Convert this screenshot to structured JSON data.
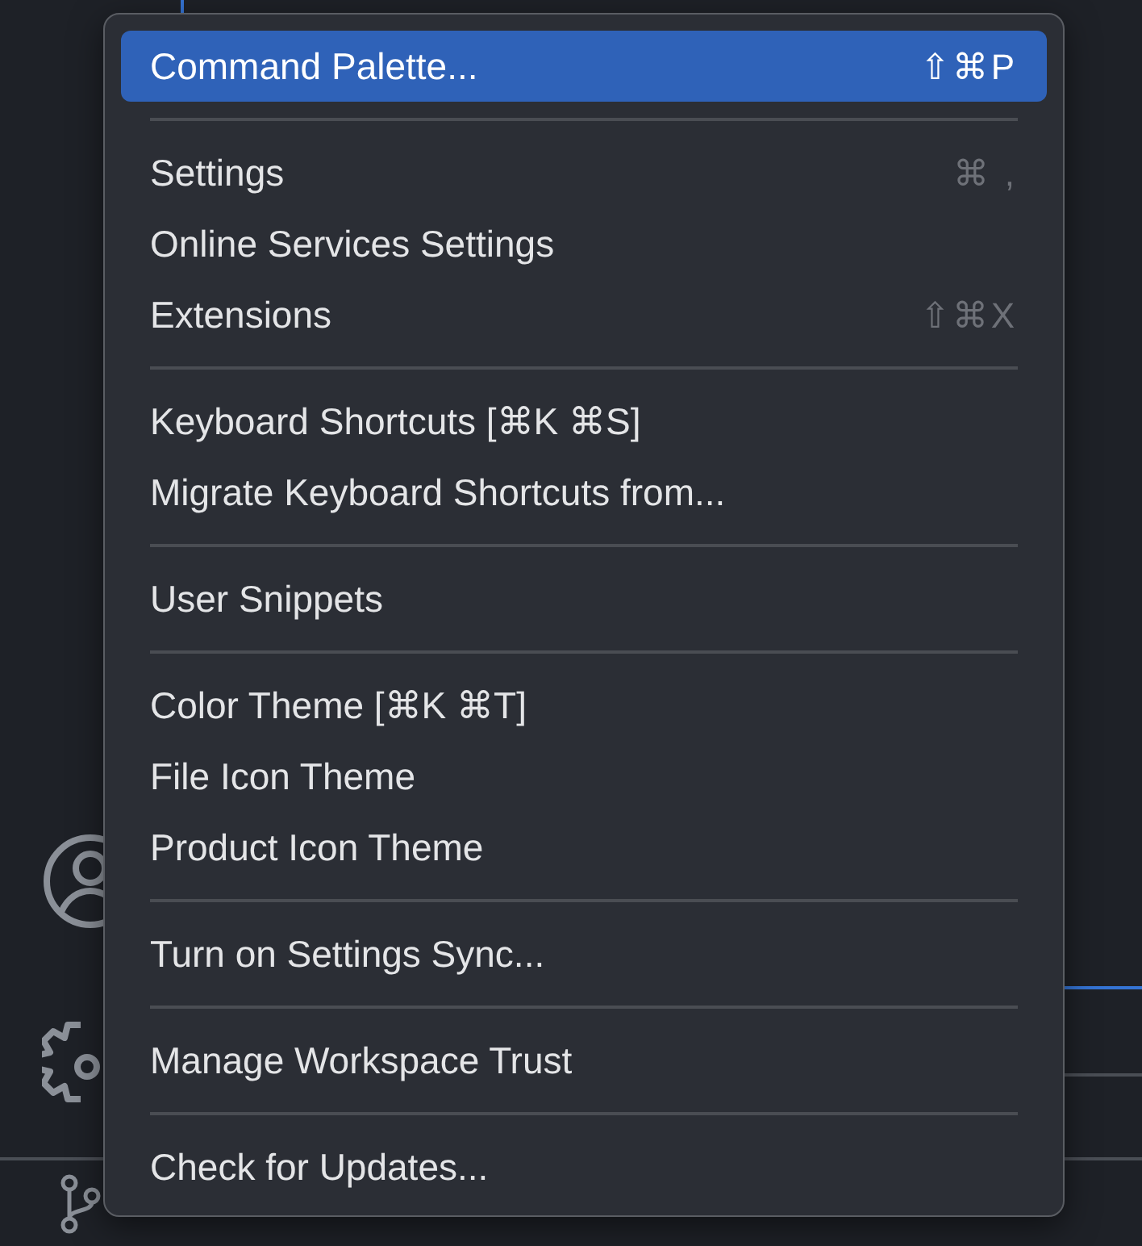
{
  "menu": {
    "groups": [
      {
        "items": [
          {
            "label": "Command Palette...",
            "shortcut": "⇧⌘P",
            "selected": true
          }
        ]
      },
      {
        "items": [
          {
            "label": "Settings",
            "shortcut": "⌘ ,",
            "selected": false
          },
          {
            "label": "Online Services Settings",
            "selected": false
          },
          {
            "label": "Extensions",
            "shortcut": "⇧⌘X",
            "selected": false
          }
        ]
      },
      {
        "items": [
          {
            "label": "Keyboard Shortcuts [⌘K ⌘S]",
            "selected": false
          },
          {
            "label": "Migrate Keyboard Shortcuts from...",
            "selected": false
          }
        ]
      },
      {
        "items": [
          {
            "label": "User Snippets",
            "selected": false
          }
        ]
      },
      {
        "items": [
          {
            "label": "Color Theme [⌘K ⌘T]",
            "selected": false
          },
          {
            "label": "File Icon Theme",
            "selected": false
          },
          {
            "label": "Product Icon Theme",
            "selected": false
          }
        ]
      },
      {
        "items": [
          {
            "label": "Turn on Settings Sync...",
            "selected": false
          }
        ]
      },
      {
        "items": [
          {
            "label": "Manage Workspace Trust",
            "selected": false
          }
        ]
      },
      {
        "items": [
          {
            "label": "Check for Updates...",
            "selected": false
          }
        ]
      }
    ]
  }
}
